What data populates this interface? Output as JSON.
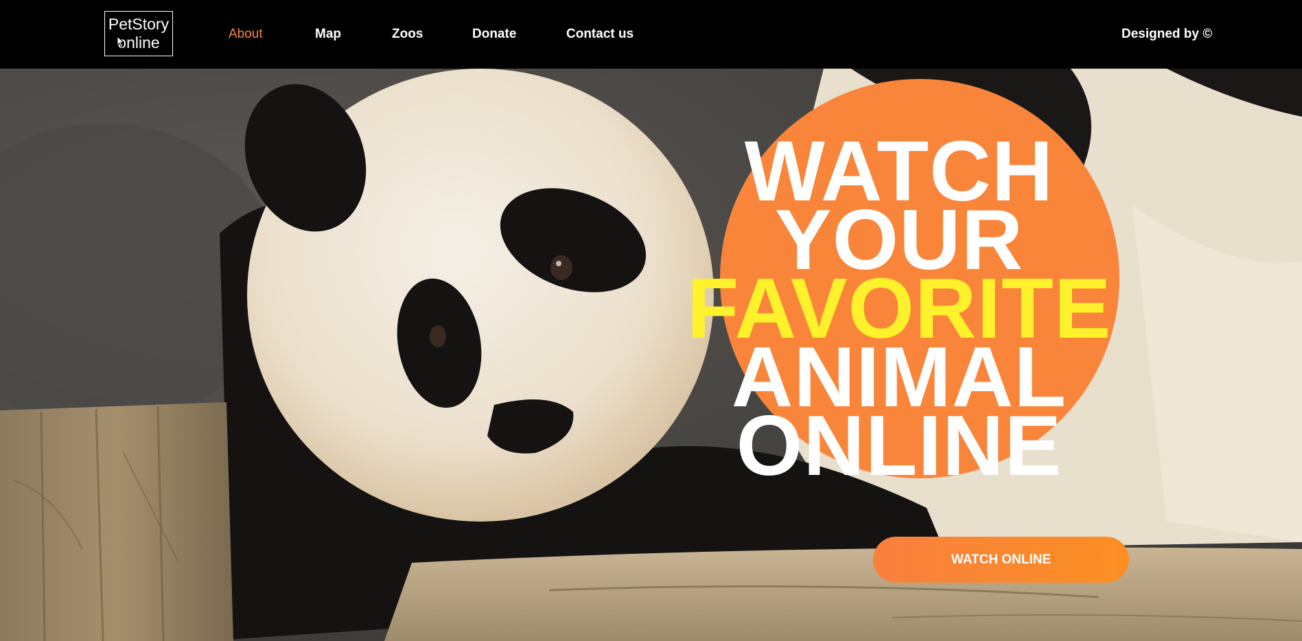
{
  "header": {
    "logo": {
      "line1": "PetStory",
      "line2": "online"
    },
    "nav": [
      {
        "label": "About",
        "active": true
      },
      {
        "label": "Map",
        "active": false
      },
      {
        "label": "Zoos",
        "active": false
      },
      {
        "label": "Donate",
        "active": false
      },
      {
        "label": "Contact us",
        "active": false
      }
    ],
    "designed_by": "Designed by ©"
  },
  "hero": {
    "headline": [
      "WATCH",
      "YOUR",
      "FAVORITE",
      "ANIMAL",
      "ONLINE"
    ],
    "highlight_word": "FAVORITE",
    "cta_label": "WATCH ONLINE"
  },
  "colors": {
    "accent": "#f9853a",
    "highlight": "#fff12b",
    "header_bg": "#000000",
    "text": "#ffffff"
  }
}
